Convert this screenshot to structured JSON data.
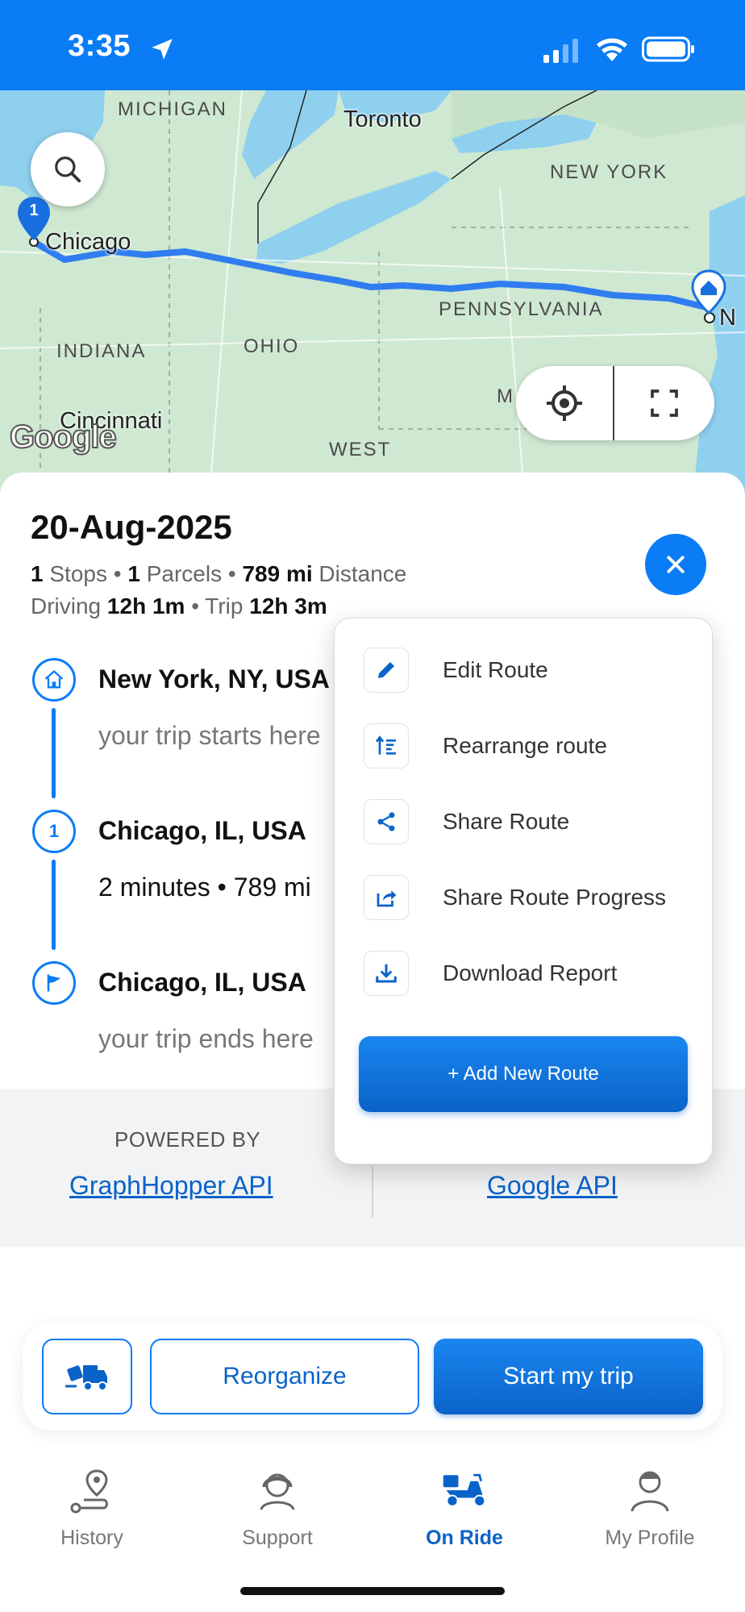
{
  "status_bar": {
    "time": "3:35"
  },
  "map": {
    "labels": {
      "michigan": "MICHIGAN",
      "new_york": "NEW YORK",
      "pennsylvania": "PENNSYLVANIA",
      "indiana": "INDIANA",
      "ohio": "OHIO",
      "west_virginia": "WEST",
      "md": "M"
    },
    "cities": {
      "toronto": "Toronto",
      "chicago": "Chicago",
      "cincinnati": "Cincinnati",
      "ny_partial": "N"
    },
    "chicago_marker": "1",
    "google_logo": "Google"
  },
  "trip": {
    "date": "20-Aug-2025",
    "stops_count": "1",
    "stops_label": "Stops",
    "parcels_count": "1",
    "parcels_label": "Parcels",
    "distance": "789 mi",
    "distance_label": "Distance",
    "driving_label": "Driving",
    "driving_time": "12h 1m",
    "trip_label": "Trip",
    "trip_time": "12h 3m",
    "separator": "•"
  },
  "stops": [
    {
      "title": "New York, NY, USA",
      "subtitle": "your trip starts here"
    },
    {
      "marker": "1",
      "title": "Chicago, IL, USA",
      "subtitle": "2 minutes • 789 mi"
    },
    {
      "title": "Chicago, IL, USA",
      "subtitle": "your trip ends here"
    }
  ],
  "powered": {
    "label": "POWERED BY",
    "link1": "GraphHopper API",
    "link2": "Google API"
  },
  "menu": {
    "items": [
      {
        "label": "Edit Route",
        "icon": "pencil-icon"
      },
      {
        "label": "Rearrange route",
        "icon": "sort-icon"
      },
      {
        "label": "Share Route",
        "icon": "share-icon"
      },
      {
        "label": "Share Route Progress",
        "icon": "share-progress-icon"
      },
      {
        "label": "Download Report",
        "icon": "download-icon"
      }
    ],
    "add_button": "+ Add New Route"
  },
  "actions": {
    "reorganize": "Reorganize",
    "start": "Start my trip"
  },
  "tabs": [
    {
      "label": "History",
      "icon": "history-icon",
      "active": false
    },
    {
      "label": "Support",
      "icon": "support-icon",
      "active": false
    },
    {
      "label": "On Ride",
      "icon": "scooter-icon",
      "active": true
    },
    {
      "label": "My Profile",
      "icon": "profile-icon",
      "active": false
    }
  ],
  "colors": {
    "primary": "#0a7cf6",
    "primary_dark": "#0a63c9",
    "route": "#2f7df0",
    "water": "#8fd0ee",
    "land": "#cfe8d2"
  }
}
